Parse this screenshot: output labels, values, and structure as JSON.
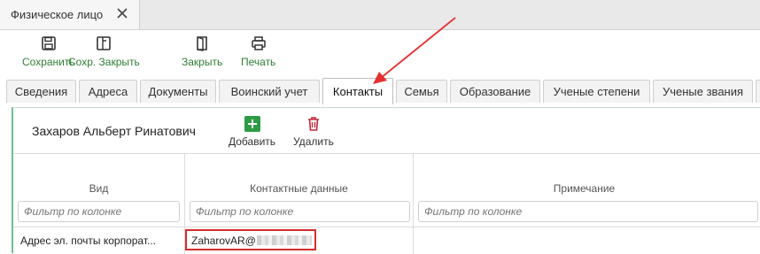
{
  "window": {
    "tab_title": "Физическое лицо"
  },
  "toolbar": {
    "save": "Сохранить",
    "save_close": "Сохр. Закрыть",
    "close": "Закрыть",
    "print": "Печать"
  },
  "tabs": [
    {
      "label": "Сведения"
    },
    {
      "label": "Адреса"
    },
    {
      "label": "Документы"
    },
    {
      "label": "Воинский учет"
    },
    {
      "label": "Контакты",
      "active": true
    },
    {
      "label": "Семья"
    },
    {
      "label": "Образование"
    },
    {
      "label": "Ученые степени"
    },
    {
      "label": "Ученые звания"
    }
  ],
  "contacts": {
    "person_name": "Захаров Альберт Ринатович",
    "add": "Добавить",
    "delete": "Удалить",
    "columns": {
      "type": "Вид",
      "data": "Контактные данные",
      "note": "Примечание"
    },
    "filter_placeholder": "Фильтр по колонке",
    "rows": [
      {
        "type": "Адрес эл. почты корпорат...",
        "data": "ZaharovAR@",
        "note": ""
      }
    ]
  },
  "colors": {
    "accent_green": "#2e7d32",
    "highlight_red": "#d62b2b",
    "panel_border": "#6fbf8f"
  }
}
